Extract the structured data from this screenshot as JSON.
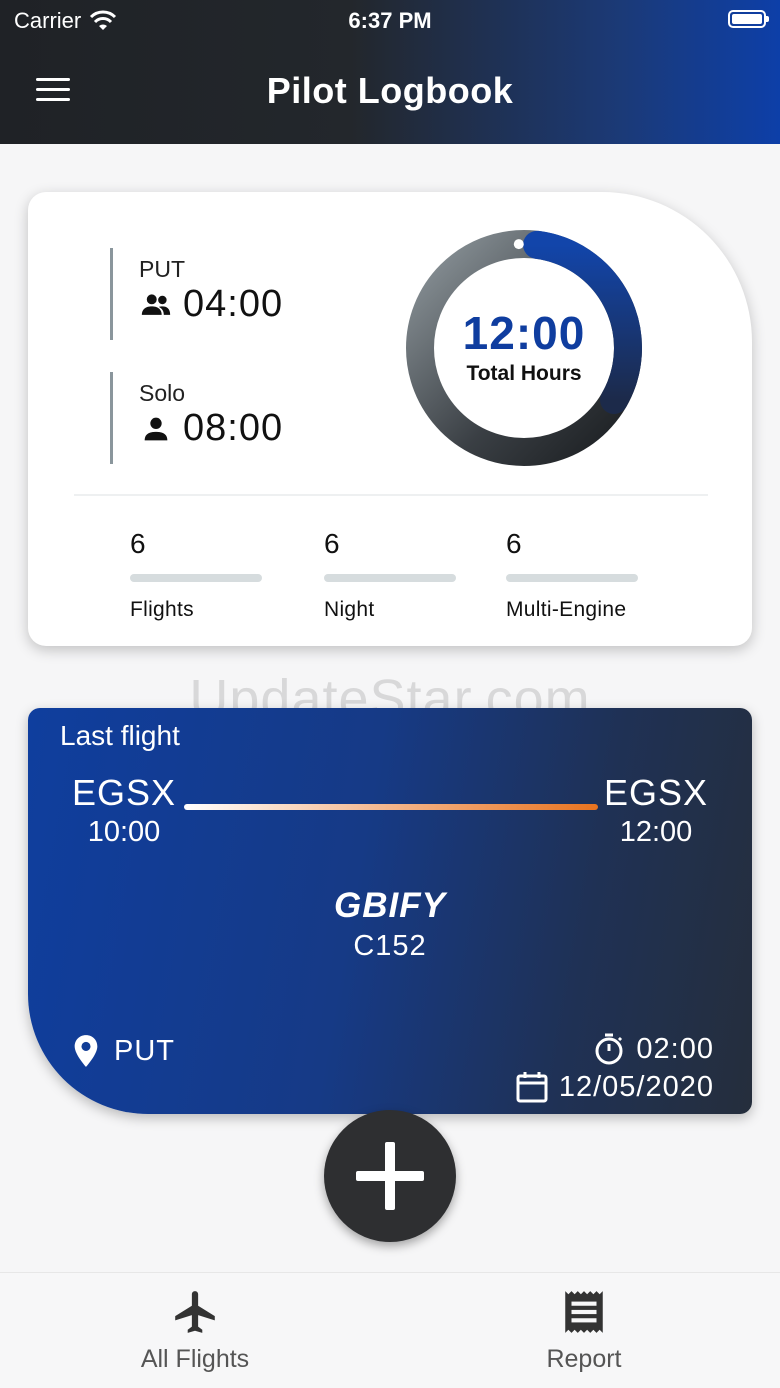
{
  "status_bar": {
    "carrier": "Carrier",
    "time": "6:37 PM"
  },
  "header": {
    "title": "Pilot Logbook"
  },
  "summary": {
    "put": {
      "label": "PUT",
      "value": "04:00"
    },
    "solo": {
      "label": "Solo",
      "value": "08:00"
    },
    "total": {
      "value": "12:00",
      "label": "Total Hours",
      "put_fraction": 0.3333
    },
    "metrics": [
      {
        "value": "6",
        "label": "Flights"
      },
      {
        "value": "6",
        "label": "Night"
      },
      {
        "value": "6",
        "label": "Multi-Engine"
      }
    ]
  },
  "watermark": "UpdateStar.com",
  "last_flight": {
    "label": "Last flight",
    "from": {
      "code": "EGSX",
      "time": "10:00"
    },
    "to": {
      "code": "EGSX",
      "time": "12:00"
    },
    "registration": "GBIFY",
    "aircraft_type": "C152",
    "role": "PUT",
    "duration": "02:00",
    "date": "12/05/2020"
  },
  "tabs": [
    {
      "label": "All Flights",
      "icon": "airplane-icon"
    },
    {
      "label": "Report",
      "icon": "receipt-icon"
    }
  ],
  "colors": {
    "accent": "#0f3d9f",
    "header_dark": "#1f2226",
    "route_end": "#e8731f"
  }
}
